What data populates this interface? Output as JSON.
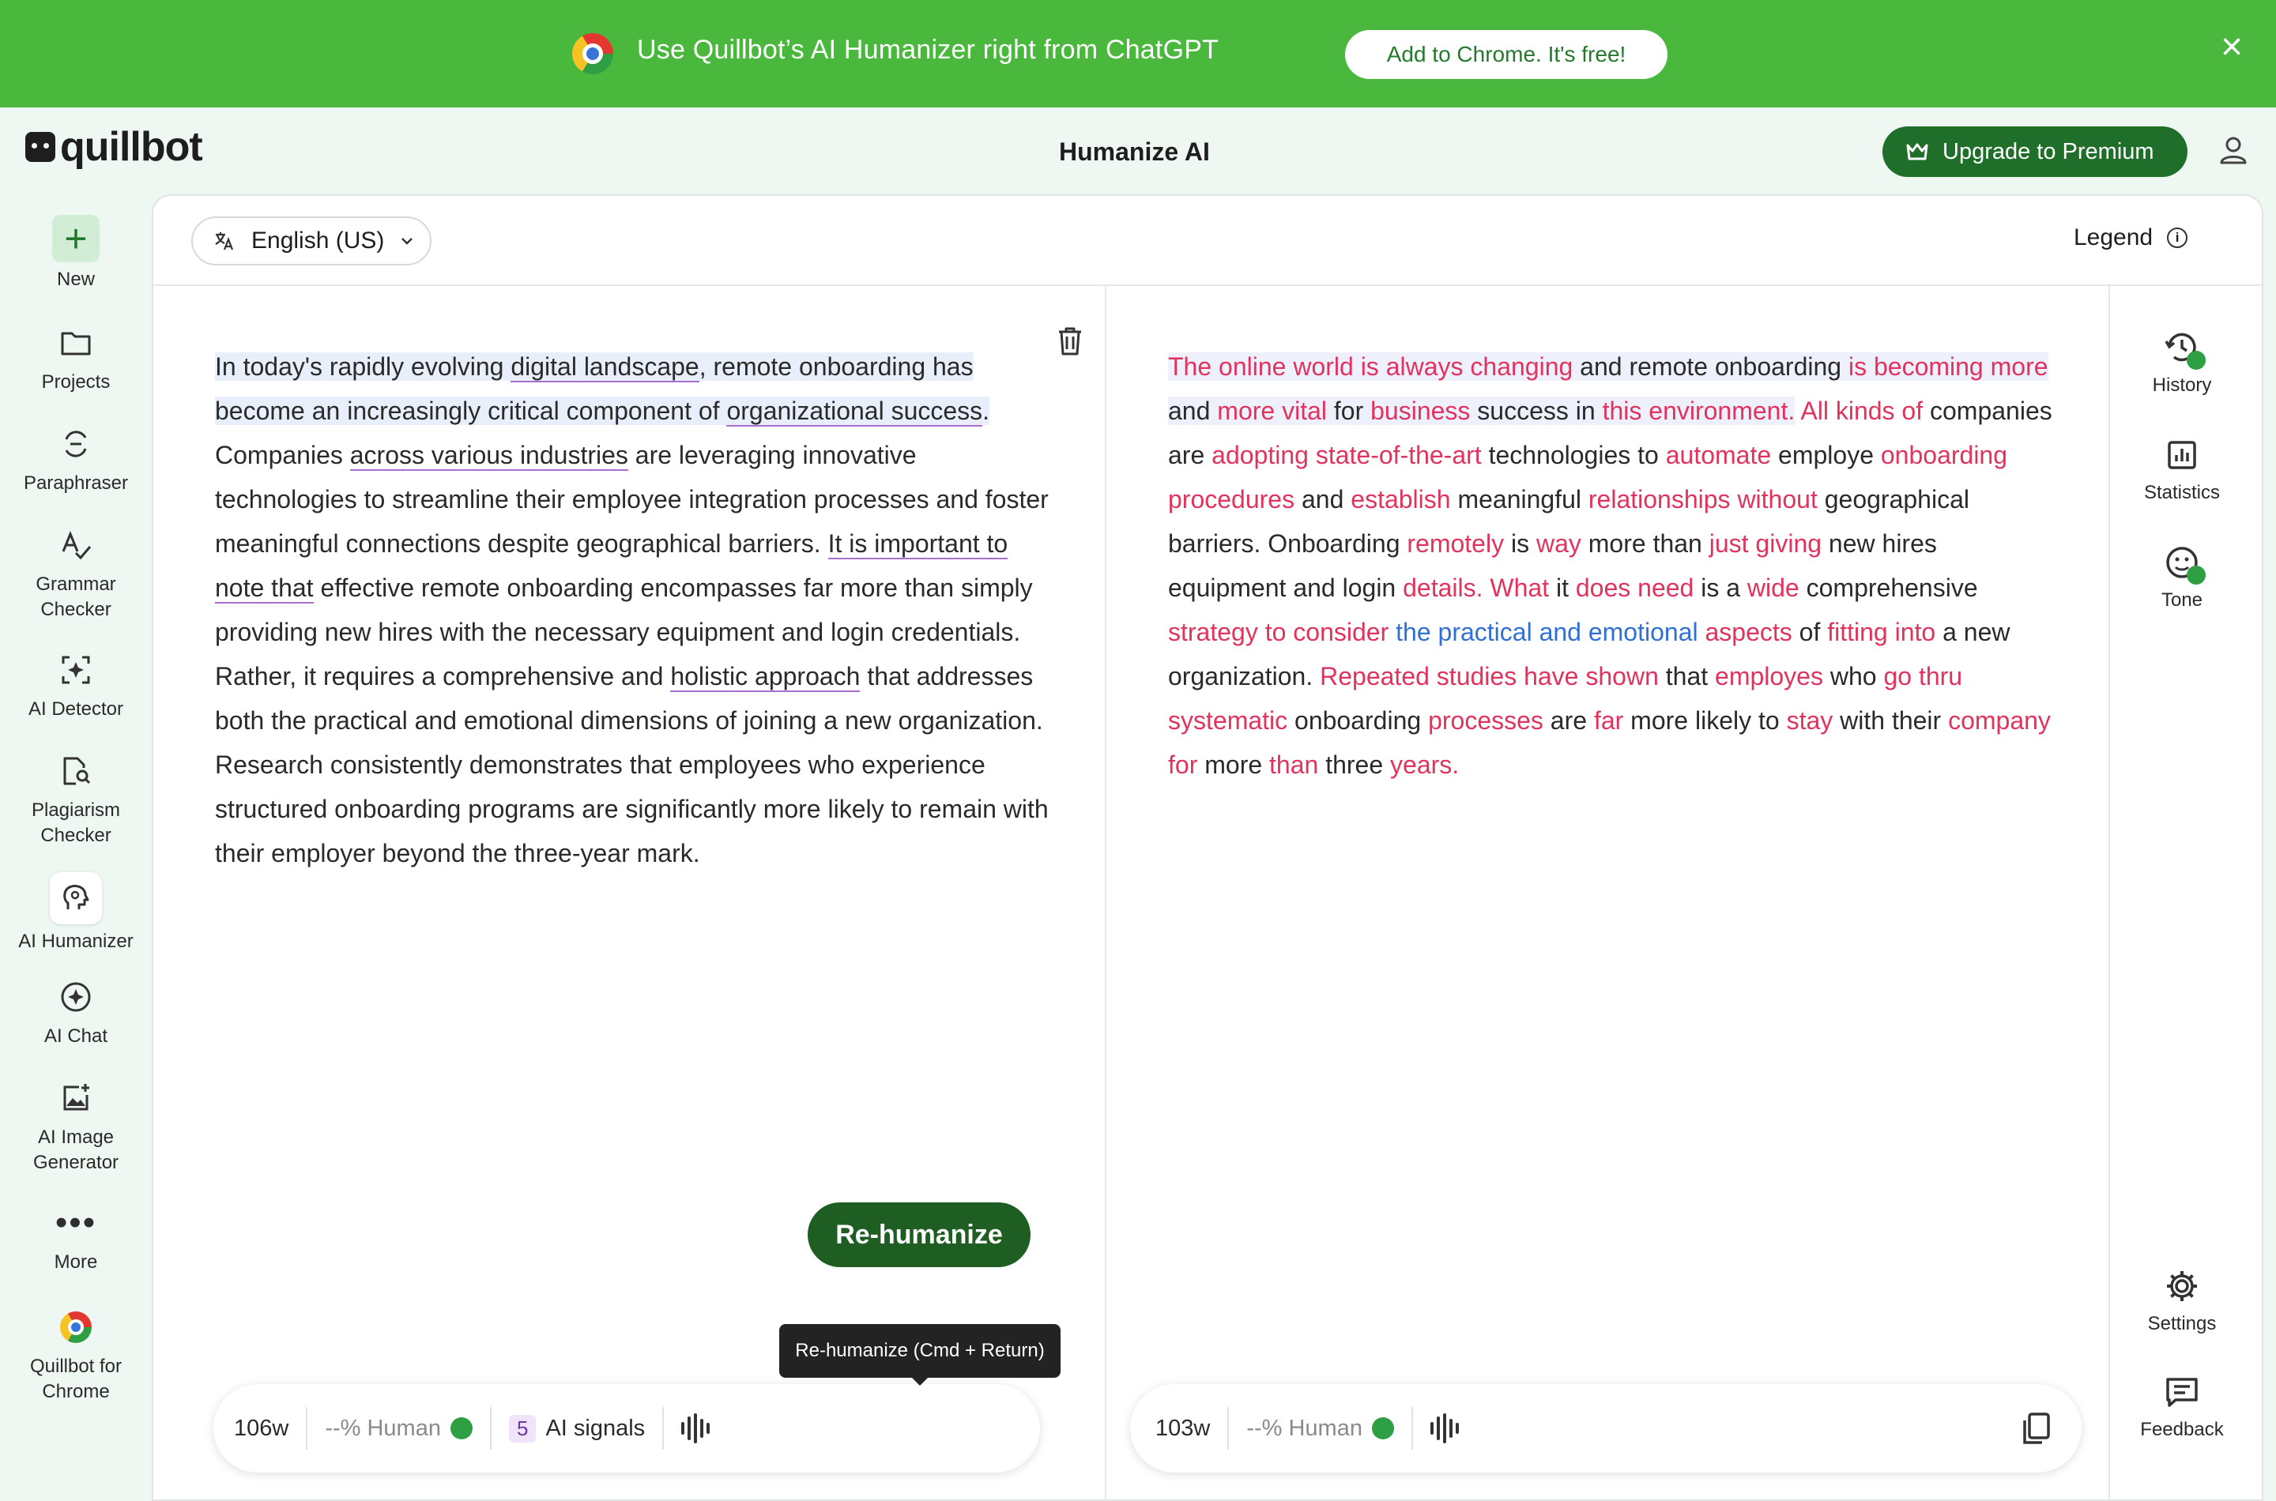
{
  "banner": {
    "text": "Use Quillbot’s AI Humanizer right from ChatGPT",
    "cta": "Add to Chrome. It's free!",
    "close_icon": "close-icon"
  },
  "header": {
    "logo_text": "quillbot",
    "title": "Humanize AI",
    "premium_label": "Upgrade to Premium"
  },
  "nav": {
    "new": "New",
    "projects": "Projects",
    "paraphraser": "Paraphraser",
    "grammar": "Grammar Checker",
    "ai_detector": "AI Detector",
    "plagiarism": "Plagiarism Checker",
    "ai_humanizer": "AI Humanizer",
    "ai_chat": "AI Chat",
    "ai_image": "AI Image Generator",
    "more": "More",
    "chrome": "Quillbot for Chrome"
  },
  "toolbar": {
    "language": "English (US)",
    "legend": "Legend"
  },
  "rail": {
    "history": "History",
    "statistics": "Statistics",
    "tone": "Tone",
    "settings": "Settings",
    "feedback": "Feedback"
  },
  "input": {
    "segments": [
      {
        "t": "In today's rapidly evolving ",
        "cls": "hl"
      },
      {
        "t": "digital landscape",
        "cls": "hl ul"
      },
      {
        "t": ", remote onboarding has become an increasingly critical component of ",
        "cls": "hl"
      },
      {
        "t": "organizational success",
        "cls": "hl ul"
      },
      {
        "t": ". ",
        "cls": "hl"
      },
      {
        "t": "Companies ",
        "cls": ""
      },
      {
        "t": "across various industries",
        "cls": "ul"
      },
      {
        "t": " are leveraging innovative technologies to streamline their employee integration processes and foster meaningful connections despite geographical barriers. ",
        "cls": ""
      },
      {
        "t": "It is important to note that",
        "cls": "ul"
      },
      {
        "t": " effective remote onboarding encompasses far more than simply providing new hires with the necessary equipment and login credentials. Rather, it requires a comprehensive and ",
        "cls": ""
      },
      {
        "t": "holistic approach",
        "cls": "ul"
      },
      {
        "t": " that addresses both the practical and emotional dimensions of joining a new organization. Research consistently demonstrates that employees who experience structured onboarding programs are significantly more likely to remain with their employer beyond the three-year mark.",
        "cls": ""
      }
    ],
    "word_count": "106w",
    "human_score": "--% Human",
    "ai_signals_count": "5",
    "ai_signals_label": "AI signals",
    "rehumanize_label": "Re-humanize",
    "tooltip": "Re-humanize (Cmd + Return)"
  },
  "output": {
    "segments": [
      {
        "t": "The online world is always changing",
        "cls": "c ohl"
      },
      {
        "t": " and remote onboarding ",
        "cls": "ohl"
      },
      {
        "t": "is becoming more",
        "cls": "c ohl"
      },
      {
        "t": " and ",
        "cls": "ohl"
      },
      {
        "t": "more vital",
        "cls": "c ohl"
      },
      {
        "t": " for ",
        "cls": "ohl"
      },
      {
        "t": "business",
        "cls": "c ohl"
      },
      {
        "t": " success in ",
        "cls": "ohl"
      },
      {
        "t": "this environment.",
        "cls": "c ohl"
      },
      {
        "t": " All kinds of",
        "cls": "c"
      },
      {
        "t": " companies are ",
        "cls": ""
      },
      {
        "t": "adopting state-of-the-art",
        "cls": "c"
      },
      {
        "t": " technologies to ",
        "cls": ""
      },
      {
        "t": "automate",
        "cls": "c"
      },
      {
        "t": " employe ",
        "cls": ""
      },
      {
        "t": "onboarding procedures",
        "cls": "c"
      },
      {
        "t": " and ",
        "cls": ""
      },
      {
        "t": "establish",
        "cls": "c"
      },
      {
        "t": " meaningful ",
        "cls": ""
      },
      {
        "t": "relationships without",
        "cls": "c"
      },
      {
        "t": " geographical barriers. Onboarding ",
        "cls": ""
      },
      {
        "t": "remotely",
        "cls": "c"
      },
      {
        "t": " is ",
        "cls": ""
      },
      {
        "t": "way",
        "cls": "c"
      },
      {
        "t": " more than ",
        "cls": ""
      },
      {
        "t": "just giving",
        "cls": "c"
      },
      {
        "t": " new hires equipment and login ",
        "cls": ""
      },
      {
        "t": "details. What",
        "cls": "c"
      },
      {
        "t": " it ",
        "cls": ""
      },
      {
        "t": "does need",
        "cls": "c"
      },
      {
        "t": " is a ",
        "cls": ""
      },
      {
        "t": "wide",
        "cls": "c"
      },
      {
        "t": " comprehensive ",
        "cls": ""
      },
      {
        "t": "strategy to consider",
        "cls": "c"
      },
      {
        "t": " ",
        "cls": ""
      },
      {
        "t": "the practical and emotional",
        "cls": "b"
      },
      {
        "t": " ",
        "cls": ""
      },
      {
        "t": "aspects",
        "cls": "c"
      },
      {
        "t": " of ",
        "cls": ""
      },
      {
        "t": "fitting into",
        "cls": "c"
      },
      {
        "t": " a new organization. ",
        "cls": ""
      },
      {
        "t": "Repeated studies have shown",
        "cls": "c"
      },
      {
        "t": " that ",
        "cls": ""
      },
      {
        "t": "employes",
        "cls": "c"
      },
      {
        "t": " who ",
        "cls": ""
      },
      {
        "t": "go thru systematic",
        "cls": "c"
      },
      {
        "t": " onboarding ",
        "cls": ""
      },
      {
        "t": "processes",
        "cls": "c"
      },
      {
        "t": " are ",
        "cls": ""
      },
      {
        "t": "far",
        "cls": "c"
      },
      {
        "t": " more likely to ",
        "cls": ""
      },
      {
        "t": "stay",
        "cls": "c"
      },
      {
        "t": " with their ",
        "cls": ""
      },
      {
        "t": "company for",
        "cls": "c"
      },
      {
        "t": " more ",
        "cls": ""
      },
      {
        "t": "than",
        "cls": "c"
      },
      {
        "t": " three ",
        "cls": ""
      },
      {
        "t": "years.",
        "cls": "c"
      }
    ],
    "word_count": "103w",
    "human_score": "--% Human"
  },
  "colors": {
    "banner_bg": "#49b83c",
    "primary": "#1f6e29",
    "changed_text": "#e0345e",
    "structural_text": "#2f6fd6",
    "ai_underline": "#a66fd0"
  }
}
